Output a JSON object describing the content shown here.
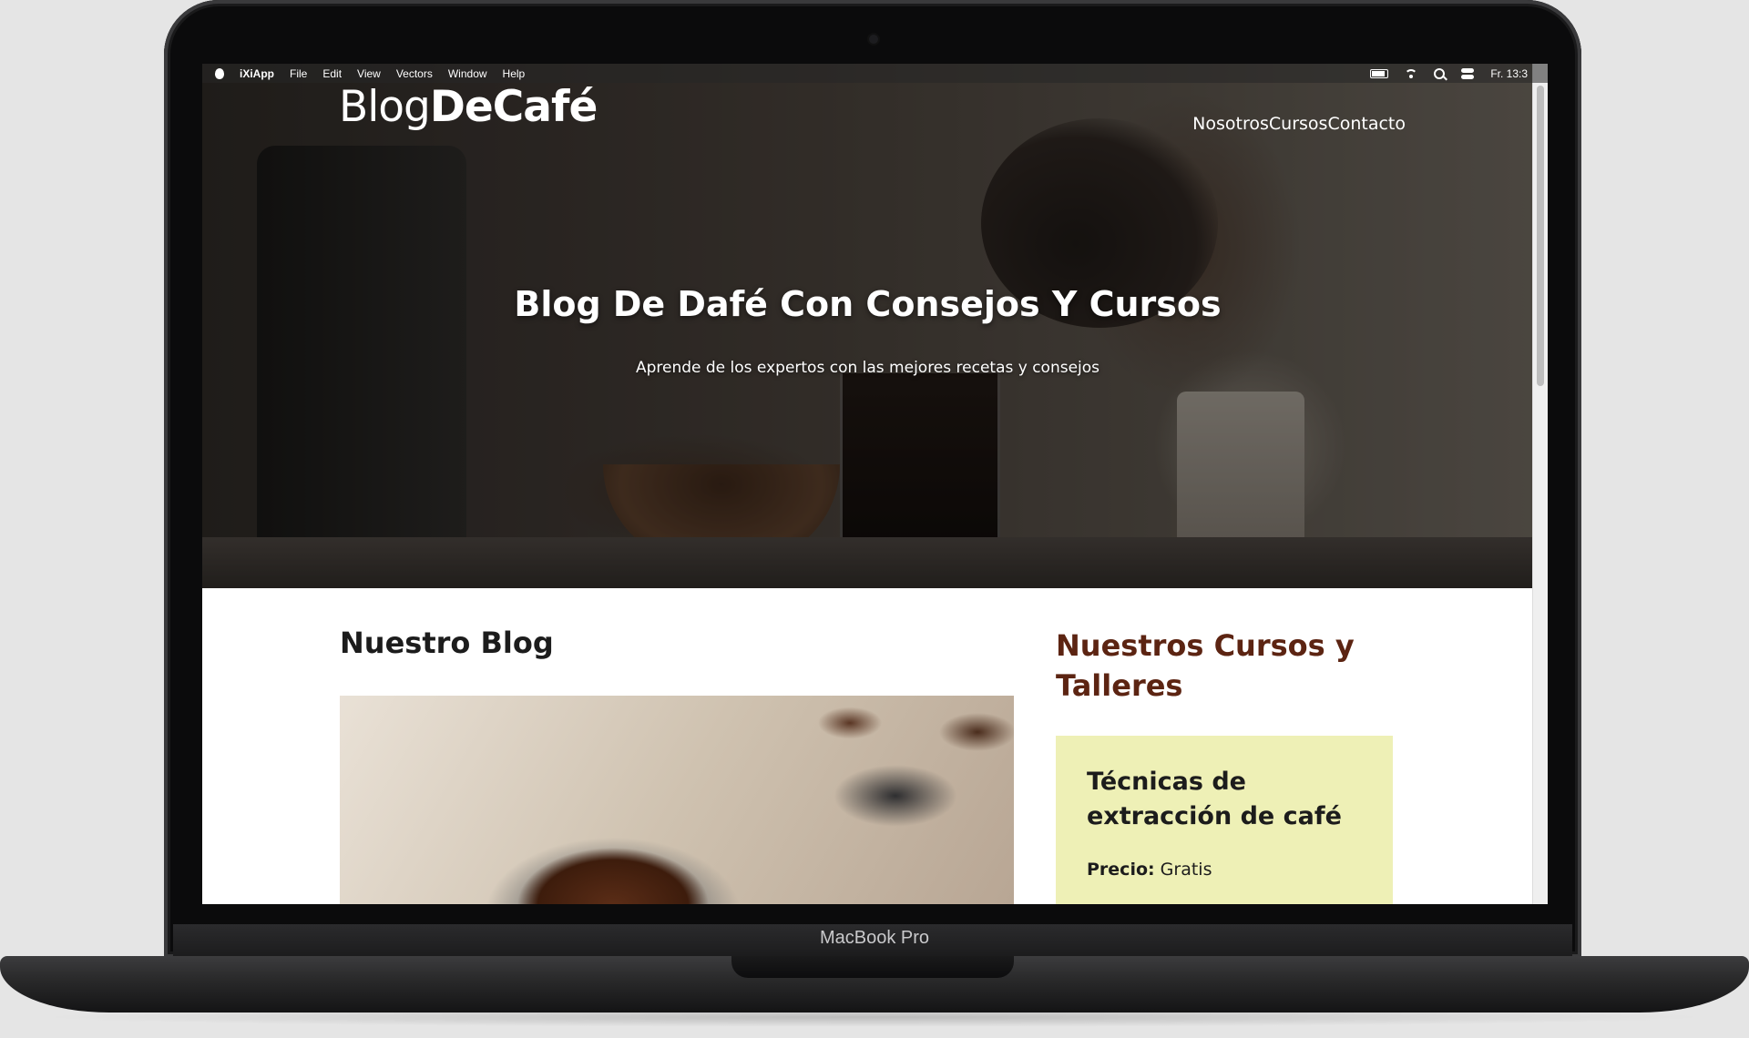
{
  "device": {
    "brand_label": "MacBook Pro"
  },
  "menubar": {
    "app_name": "iXiApp",
    "menus": [
      "File",
      "Edit",
      "View",
      "Vectors",
      "Window",
      "Help"
    ],
    "clock": "Fr. 13:3"
  },
  "site": {
    "logo_light": "Blog",
    "logo_bold": "DeCafé",
    "nav": [
      "Nosotros",
      "Cursos",
      "Contacto"
    ]
  },
  "hero": {
    "title": "Blog De Dafé Con Consejos Y Cursos",
    "subtitle": "Aprende de los expertos con las mejores recetas y consejos"
  },
  "blog": {
    "heading": "Nuestro Blog"
  },
  "courses": {
    "heading": "Nuestros Cursos y Talleres",
    "items": [
      {
        "title": "Técnicas de extracción de café",
        "price_label": "Precio:",
        "price_value": "Gratis"
      }
    ]
  },
  "colors": {
    "course_heading": "#5c2412",
    "course_card_bg": "#eef0b6"
  }
}
